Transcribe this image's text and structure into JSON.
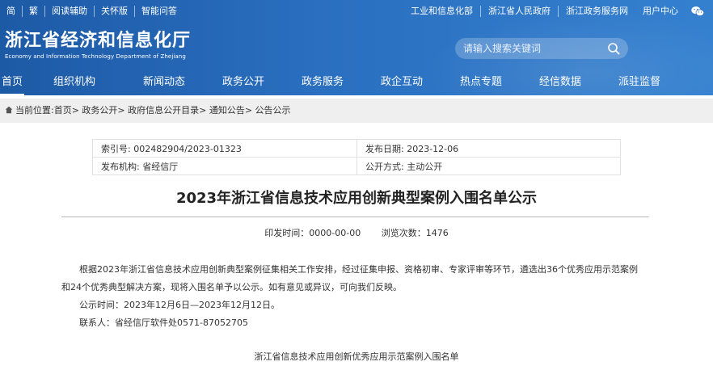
{
  "topbar": {
    "left": [
      "简",
      "繁",
      "阅读辅助",
      "关怀版",
      "智能问答"
    ],
    "right": [
      "工业和信息化部",
      "浙江省人民政府",
      "浙江政务服务网",
      "用户中心"
    ],
    "wechat_icon": "wechat-icon"
  },
  "brand": {
    "cn": "浙江省经济和信息化厅",
    "en": "Economy and Information Technology Department of Zhejiang"
  },
  "search": {
    "placeholder": "请输入搜索关键词",
    "icon": "search-icon"
  },
  "nav": [
    "首页",
    "组织机构",
    "新闻动态",
    "政务公开",
    "政务服务",
    "政企互动",
    "热点专题",
    "经信数据",
    "派驻监督"
  ],
  "breadcrumb": "当前位置:首页> 政务公开> 政府信息公开目录> 通知公告> 公告公示",
  "meta": {
    "index_no": "索引号: 002482904/2023-01323",
    "publish_date": "发布日期: 2023-12-06",
    "issuer": "发布机构: 省经信厅",
    "open_mode": "公开方式: 主动公开"
  },
  "article": {
    "title": "2023年浙江省信息技术应用创新典型案例入围名单公示",
    "issue_time": "印发时间：0000-00-00",
    "views": "浏览次数：1476",
    "para1_line1": "根据2023年浙江省信息技术应用创新典型案例征集相关工作安排，经过征集申报、资格初审、专家评审等环节，遴选出36个优秀应用示范案例",
    "para1_line2": "和24个优秀典型解决方案，现将入围名单予以公示。如有意见或异议，可向我们反映。",
    "period": "公示时间：2023年12月6日—2023年12月12日。",
    "contact": "联系人：省经信厅软件处0571-87052705",
    "attachment_title": "浙江省信息技术应用创新优秀应用示范案例入围名单"
  },
  "colors": {
    "header_blue": "#1d5aa6",
    "breadcrumb_bg": "#efefef"
  }
}
